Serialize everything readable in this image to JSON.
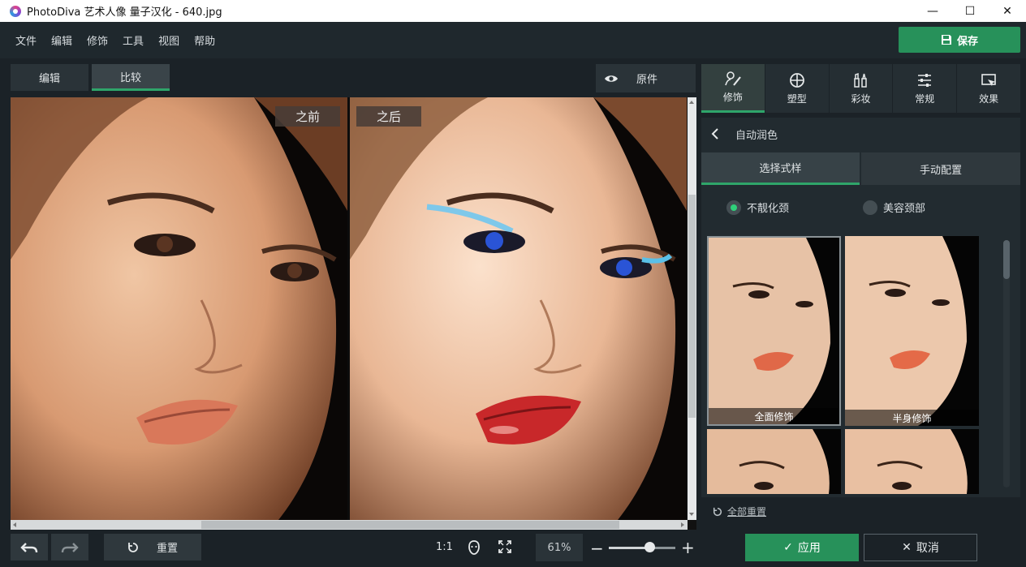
{
  "window": {
    "title": "PhotoDiva 艺术人像 量子汉化 - 640.jpg",
    "minimize": "—",
    "maximize": "☐",
    "close": "✕"
  },
  "menu": [
    "文件",
    "编辑",
    "修饰",
    "工具",
    "视图",
    "帮助"
  ],
  "save_label": "保存",
  "view_tabs": {
    "edit": "编辑",
    "compare": "比较"
  },
  "original_label": "原件",
  "viewer": {
    "before_label": "之前",
    "after_label": "之后"
  },
  "tool_tabs": [
    {
      "label": "修饰",
      "icon": "retouch-icon"
    },
    {
      "label": "塑型",
      "icon": "shape-icon"
    },
    {
      "label": "彩妆",
      "icon": "makeup-icon"
    },
    {
      "label": "常规",
      "icon": "sliders-icon"
    },
    {
      "label": "效果",
      "icon": "effects-icon"
    }
  ],
  "panel": {
    "back_title": "自动润色",
    "segments": {
      "choose": "选择式样",
      "manual": "手动配置"
    },
    "radios": {
      "no_neck": "不靓化颈",
      "neck": "美容颈部"
    },
    "presets": [
      "全面修饰",
      "半身修饰"
    ]
  },
  "reset_all": "全部重置",
  "bottom": {
    "reset": "重置",
    "ratio": "1:1",
    "zoom": "61%",
    "zoom_fraction": 0.61
  },
  "apply": "应用",
  "cancel": "取消",
  "colors": {
    "accent": "#27915a",
    "tab_underline": "#2fa56a"
  }
}
